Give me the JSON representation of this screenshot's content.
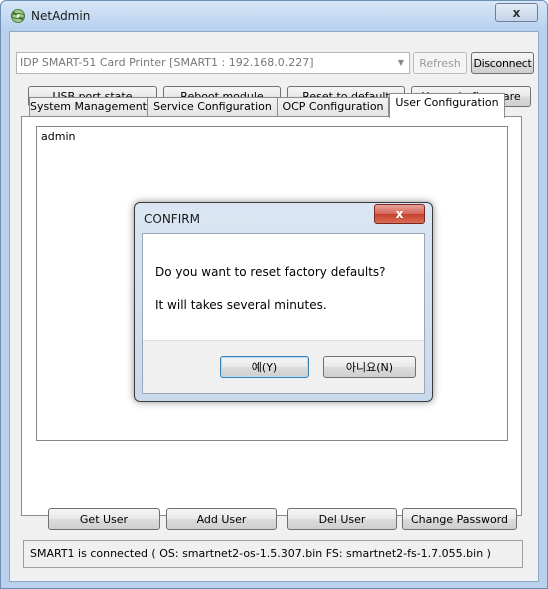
{
  "window": {
    "title": "NetAdmin",
    "close_glyph": "x"
  },
  "connection": {
    "device_value": "IDP SMART-51 Card Printer  [SMART1 : 192.168.0.227]",
    "refresh_label": "Refresh",
    "disconnect_label": "Disconnect"
  },
  "actions": {
    "usb_port_state": "USB port state",
    "reboot_module": "Reboot module",
    "reset_to_default": "Reset to default",
    "upgrade_firmware": "Upgrade firmware"
  },
  "tabs": [
    {
      "label": "System Management"
    },
    {
      "label": "Service Configuration"
    },
    {
      "label": "OCP Configuration"
    },
    {
      "label": "User Configuration"
    }
  ],
  "users": [
    "admin"
  ],
  "user_buttons": {
    "get_user": "Get User",
    "add_user": "Add User",
    "del_user": "Del User",
    "change_password": "Change Password"
  },
  "status_text": "SMART1 is connected ( OS: smartnet2-os-1.5.307.bin  FS: smartnet2-fs-1.7.055.bin )",
  "dialog": {
    "title": "CONFIRM",
    "close_glyph": "x",
    "message_line1": "Do you want to reset factory defaults?",
    "message_line2": "It will takes several minutes.",
    "yes_label": "예(Y)",
    "no_label": "아니요(N)"
  },
  "colors": {
    "accent": "#3c7fb1",
    "close_red": "#c8402f"
  },
  "icons": {
    "app": "netadmin-app-icon",
    "combo_arrow": "chevron-down-icon"
  }
}
